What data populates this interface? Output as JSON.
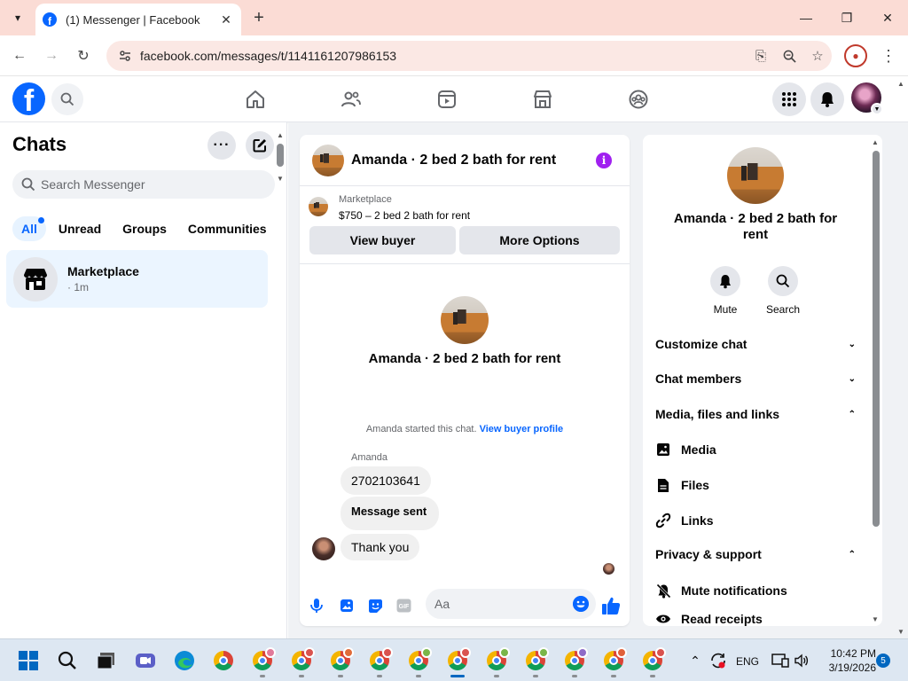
{
  "browser": {
    "tab_title": "(1) Messenger | Facebook",
    "url": "facebook.com/messages/t/1141161207986153"
  },
  "chats": {
    "title": "Chats",
    "search_placeholder": "Search Messenger",
    "filters": [
      "All",
      "Unread",
      "Groups",
      "Communities"
    ],
    "items": [
      {
        "name": "Marketplace",
        "time": "· 1m"
      }
    ]
  },
  "conversation": {
    "title": "Amanda · 2 bed 2 bath for rent",
    "marketplace_label": "Marketplace",
    "listing": "$750 – 2 bed 2 bath for rent",
    "view_buyer": "View buyer",
    "more_options": "More Options",
    "center_name": "Amanda · 2 bed 2 bath for rent",
    "started_text": "Amanda started this chat.",
    "view_buyer_profile": "View buyer profile",
    "sender": "Amanda",
    "messages": [
      "2702103641",
      "Message sent",
      "Thank you"
    ],
    "composer_placeholder": "Aa"
  },
  "info_panel": {
    "name": "Amanda · 2 bed 2 bath for rent",
    "actions": [
      "Mute",
      "Search"
    ],
    "sections": [
      "Customize chat",
      "Chat members",
      "Media, files and links",
      "Privacy & support"
    ],
    "media_items": [
      "Media",
      "Files",
      "Links"
    ],
    "privacy_items": [
      "Mute notifications",
      "Read receipts"
    ]
  },
  "taskbar": {
    "language": "ENG",
    "time": "10:42 PM",
    "date": "3/19/2026",
    "notifications": "5"
  },
  "colors": {
    "accent": "#0866ff",
    "info_icon": "#a020f0",
    "tab_strip": "#fbdcd5"
  }
}
